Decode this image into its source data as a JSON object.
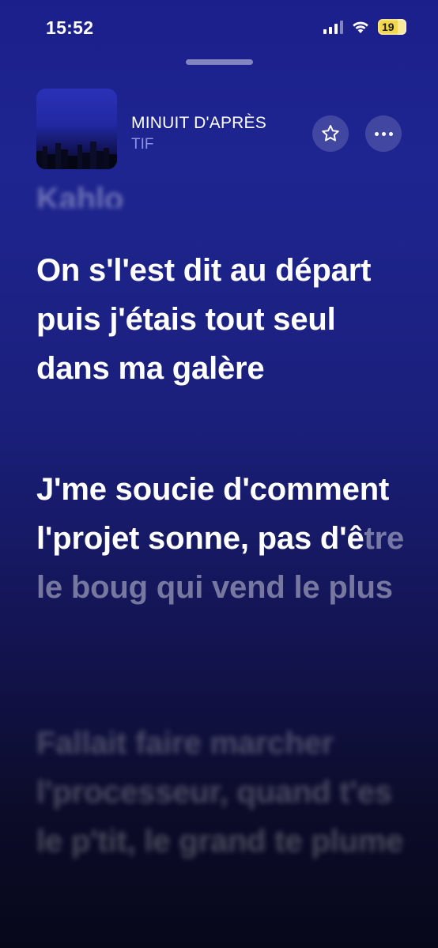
{
  "status_bar": {
    "time": "15:52",
    "battery": "19",
    "battery_color": "#f2d64b"
  },
  "song": {
    "title": "MINUIT D'APRÈS",
    "artist": "TIF",
    "artist_color": "#8d92e6"
  },
  "actions": {
    "favorite_icon": "star-icon",
    "more_icon": "ellipsis-icon"
  },
  "lyrics": {
    "previous_line": "Kahlo",
    "current_line": "On s'l'est dit au départ puis j'étais tout seul dans ma galère",
    "active_line_sung": "J'me soucie d'comment l'projet sonne, pas d'ê",
    "active_line_unsung": "tre le boug qui vend le plus",
    "active_line_line3_sung": "bo",
    "active_line_line3_unsung": "ug qui vend le",
    "active_line_line4": "plus",
    "next_line": "Fallait faire marcher l'processeur, quand t'es le p'tit, le grand te plume"
  }
}
